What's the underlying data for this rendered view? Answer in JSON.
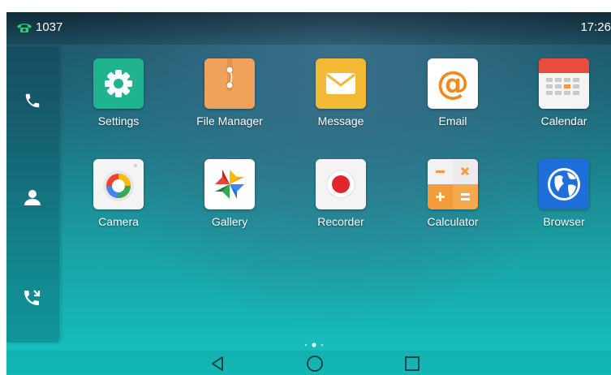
{
  "status_bar": {
    "line_number": "1037",
    "time": "17:26",
    "line_icon": "phone-handset-icon"
  },
  "dock": {
    "items": [
      {
        "name": "phone",
        "icon": "phone-icon"
      },
      {
        "name": "contacts",
        "icon": "person-icon"
      },
      {
        "name": "call-history",
        "icon": "call-log-icon"
      }
    ]
  },
  "apps": [
    {
      "label": "Settings",
      "icon": "gear-icon",
      "color": "#1fb38f"
    },
    {
      "label": "File Manager",
      "icon": "folder-icon",
      "color": "#f0a25a"
    },
    {
      "label": "Message",
      "icon": "envelope-icon",
      "color": "#f2b934"
    },
    {
      "label": "Email",
      "icon": "at-sign-icon",
      "color": "#ffffff"
    },
    {
      "label": "Calendar",
      "icon": "calendar-icon",
      "color": "#e84c3d"
    },
    {
      "label": "Camera",
      "icon": "camera-icon",
      "color": "#f4f4f4"
    },
    {
      "label": "Gallery",
      "icon": "pinwheel-icon",
      "color": "#ffffff"
    },
    {
      "label": "Recorder",
      "icon": "record-icon",
      "color": "#f4f4f4"
    },
    {
      "label": "Calculator",
      "icon": "calculator-icon",
      "color": "#f39c3c"
    },
    {
      "label": "Browser",
      "icon": "globe-icon",
      "color": "#1e6fd9"
    }
  ],
  "navigation": {
    "back_icon": "back-triangle-icon",
    "home_icon": "home-circle-icon",
    "recents_icon": "recents-square-icon"
  },
  "page_indicator": {
    "page_count": 3,
    "current_page": 2
  }
}
